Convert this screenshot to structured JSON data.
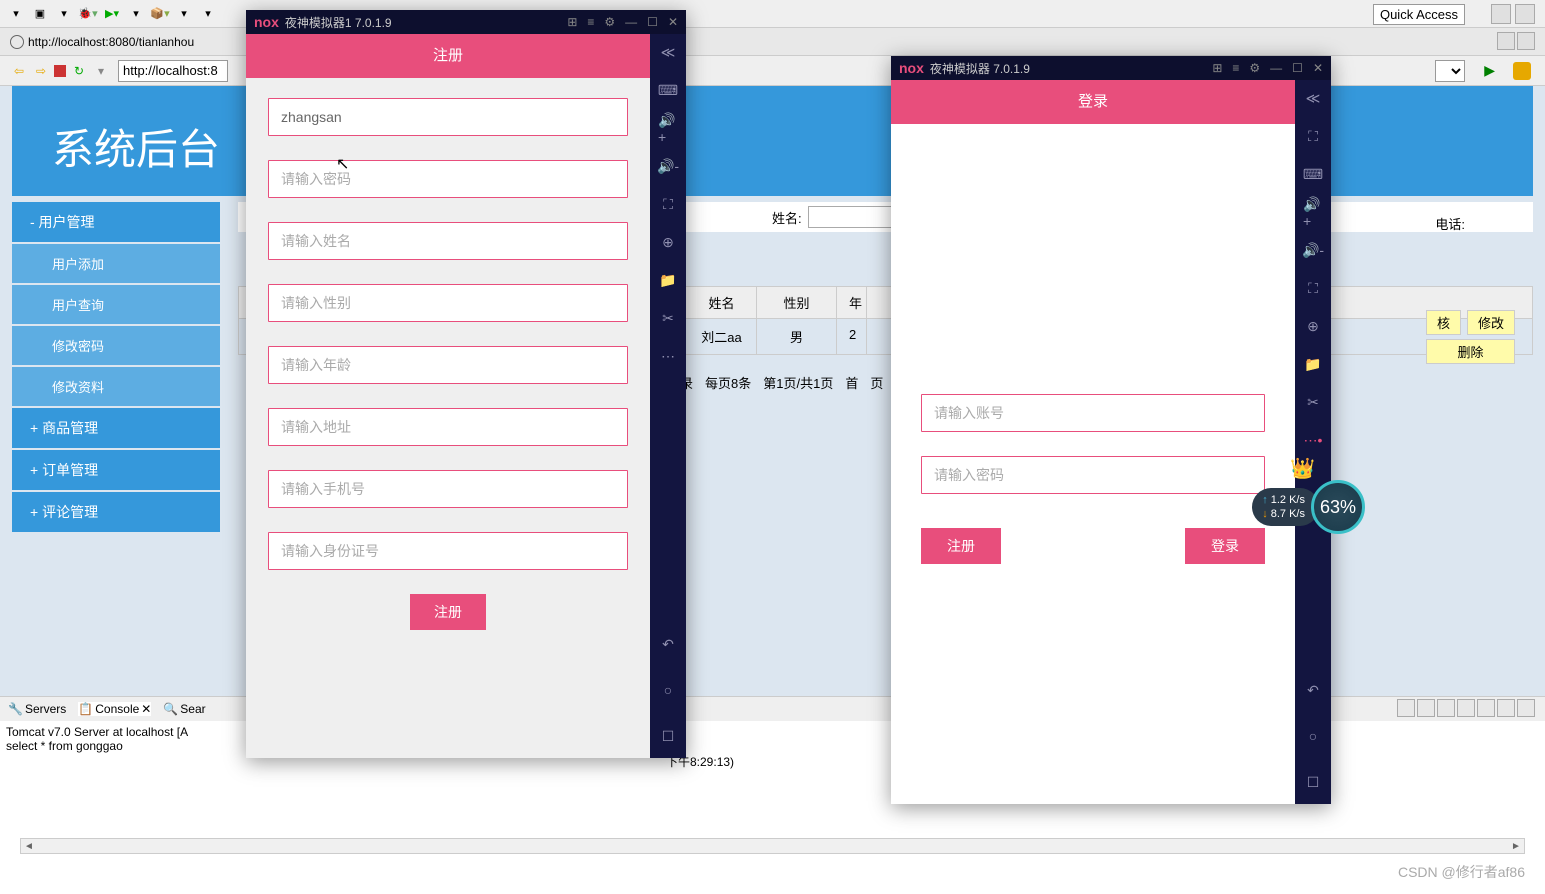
{
  "ide": {
    "quick_access": "Quick Access",
    "browser_tab_url": "http://localhost:8080/tianlanhou",
    "address_url": "http://localhost:8",
    "servers_tab": "Servers",
    "console_tab": "Console",
    "search_tab": "Sear",
    "console_line1": "Tomcat v7.0 Server at localhost [A",
    "console_line2": "select * from gonggao",
    "console_timestamp": "下午8:29:13)"
  },
  "page": {
    "header_title": "系统后台",
    "sidebar": {
      "user_mgmt": "- 用户管理",
      "user_add": "用户添加",
      "user_query": "用户查询",
      "change_pwd": "修改密码",
      "change_profile": "修改资料",
      "product_mgmt": "+ 商品管理",
      "order_mgmt": "+ 订单管理",
      "review_mgmt": "+ 评论管理"
    },
    "filters": {
      "name_label": "姓名:",
      "phone_label": "电话:"
    },
    "table": {
      "col_name": "姓名",
      "col_sex": "性别",
      "col_age": "年",
      "row1_name": "刘二aa",
      "row1_sex": "男",
      "row1_age": "2"
    },
    "actions": {
      "review": "核",
      "edit": "修改",
      "delete": "删除"
    },
    "pagination": {
      "total": "录",
      "per_page": "每页8条",
      "page_info": "第1页/共1页",
      "first": "首",
      "last": "页"
    }
  },
  "emulator1": {
    "title": "夜神模拟器1 7.0.1.9",
    "app_title": "注册",
    "input_username": "zhangsan",
    "ph_password": "请输入密码",
    "ph_name": "请输入姓名",
    "ph_sex": "请输入性别",
    "ph_age": "请输入年龄",
    "ph_address": "请输入地址",
    "ph_phone": "请输入手机号",
    "ph_idcard": "请输入身份证号",
    "btn_register": "注册"
  },
  "emulator2": {
    "title": "夜神模拟器 7.0.1.9",
    "app_title": "登录",
    "ph_account": "请输入账号",
    "ph_password": "请输入密码",
    "btn_register": "注册",
    "btn_login": "登录"
  },
  "speed": {
    "up": "1.2 K/s",
    "down": "8.7 K/s",
    "circle": "63%"
  },
  "watermark": "CSDN @修行者af86"
}
